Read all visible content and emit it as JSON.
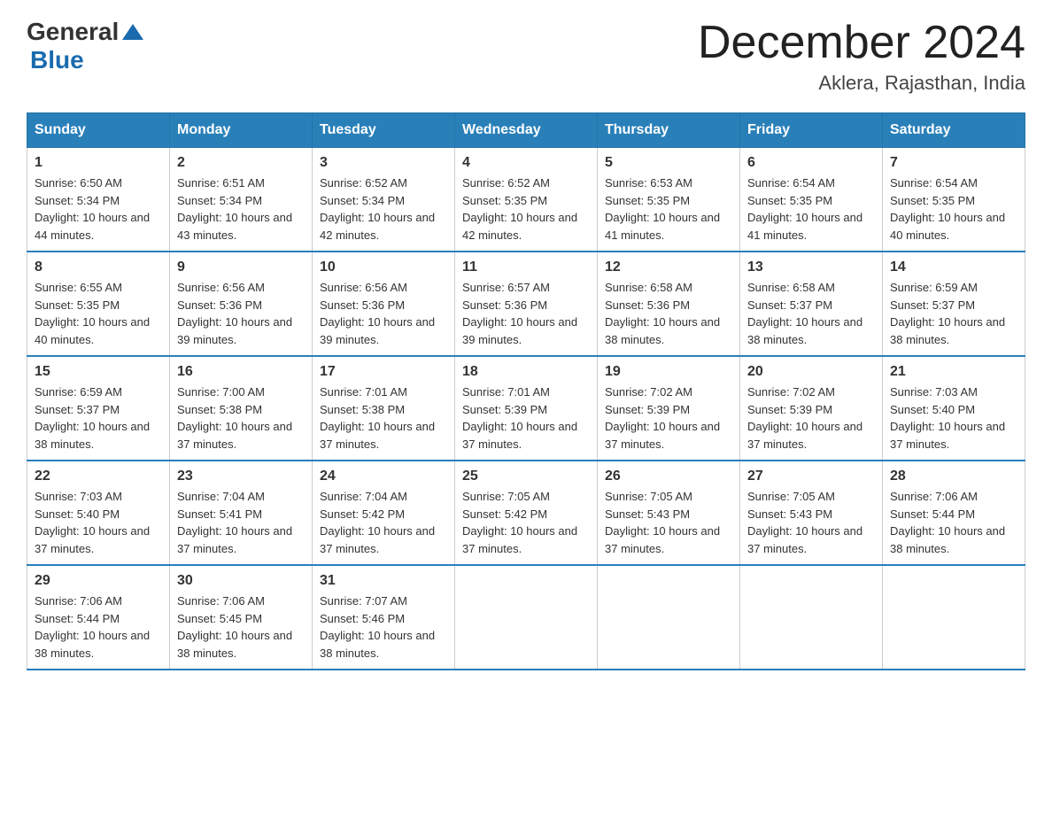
{
  "logo": {
    "text_general": "General",
    "text_blue": "Blue"
  },
  "header": {
    "month": "December 2024",
    "location": "Aklera, Rajasthan, India"
  },
  "weekdays": [
    "Sunday",
    "Monday",
    "Tuesday",
    "Wednesday",
    "Thursday",
    "Friday",
    "Saturday"
  ],
  "weeks": [
    [
      {
        "day": "1",
        "sunrise": "6:50 AM",
        "sunset": "5:34 PM",
        "daylight": "10 hours and 44 minutes."
      },
      {
        "day": "2",
        "sunrise": "6:51 AM",
        "sunset": "5:34 PM",
        "daylight": "10 hours and 43 minutes."
      },
      {
        "day": "3",
        "sunrise": "6:52 AM",
        "sunset": "5:34 PM",
        "daylight": "10 hours and 42 minutes."
      },
      {
        "day": "4",
        "sunrise": "6:52 AM",
        "sunset": "5:35 PM",
        "daylight": "10 hours and 42 minutes."
      },
      {
        "day": "5",
        "sunrise": "6:53 AM",
        "sunset": "5:35 PM",
        "daylight": "10 hours and 41 minutes."
      },
      {
        "day": "6",
        "sunrise": "6:54 AM",
        "sunset": "5:35 PM",
        "daylight": "10 hours and 41 minutes."
      },
      {
        "day": "7",
        "sunrise": "6:54 AM",
        "sunset": "5:35 PM",
        "daylight": "10 hours and 40 minutes."
      }
    ],
    [
      {
        "day": "8",
        "sunrise": "6:55 AM",
        "sunset": "5:35 PM",
        "daylight": "10 hours and 40 minutes."
      },
      {
        "day": "9",
        "sunrise": "6:56 AM",
        "sunset": "5:36 PM",
        "daylight": "10 hours and 39 minutes."
      },
      {
        "day": "10",
        "sunrise": "6:56 AM",
        "sunset": "5:36 PM",
        "daylight": "10 hours and 39 minutes."
      },
      {
        "day": "11",
        "sunrise": "6:57 AM",
        "sunset": "5:36 PM",
        "daylight": "10 hours and 39 minutes."
      },
      {
        "day": "12",
        "sunrise": "6:58 AM",
        "sunset": "5:36 PM",
        "daylight": "10 hours and 38 minutes."
      },
      {
        "day": "13",
        "sunrise": "6:58 AM",
        "sunset": "5:37 PM",
        "daylight": "10 hours and 38 minutes."
      },
      {
        "day": "14",
        "sunrise": "6:59 AM",
        "sunset": "5:37 PM",
        "daylight": "10 hours and 38 minutes."
      }
    ],
    [
      {
        "day": "15",
        "sunrise": "6:59 AM",
        "sunset": "5:37 PM",
        "daylight": "10 hours and 38 minutes."
      },
      {
        "day": "16",
        "sunrise": "7:00 AM",
        "sunset": "5:38 PM",
        "daylight": "10 hours and 37 minutes."
      },
      {
        "day": "17",
        "sunrise": "7:01 AM",
        "sunset": "5:38 PM",
        "daylight": "10 hours and 37 minutes."
      },
      {
        "day": "18",
        "sunrise": "7:01 AM",
        "sunset": "5:39 PM",
        "daylight": "10 hours and 37 minutes."
      },
      {
        "day": "19",
        "sunrise": "7:02 AM",
        "sunset": "5:39 PM",
        "daylight": "10 hours and 37 minutes."
      },
      {
        "day": "20",
        "sunrise": "7:02 AM",
        "sunset": "5:39 PM",
        "daylight": "10 hours and 37 minutes."
      },
      {
        "day": "21",
        "sunrise": "7:03 AM",
        "sunset": "5:40 PM",
        "daylight": "10 hours and 37 minutes."
      }
    ],
    [
      {
        "day": "22",
        "sunrise": "7:03 AM",
        "sunset": "5:40 PM",
        "daylight": "10 hours and 37 minutes."
      },
      {
        "day": "23",
        "sunrise": "7:04 AM",
        "sunset": "5:41 PM",
        "daylight": "10 hours and 37 minutes."
      },
      {
        "day": "24",
        "sunrise": "7:04 AM",
        "sunset": "5:42 PM",
        "daylight": "10 hours and 37 minutes."
      },
      {
        "day": "25",
        "sunrise": "7:05 AM",
        "sunset": "5:42 PM",
        "daylight": "10 hours and 37 minutes."
      },
      {
        "day": "26",
        "sunrise": "7:05 AM",
        "sunset": "5:43 PM",
        "daylight": "10 hours and 37 minutes."
      },
      {
        "day": "27",
        "sunrise": "7:05 AM",
        "sunset": "5:43 PM",
        "daylight": "10 hours and 37 minutes."
      },
      {
        "day": "28",
        "sunrise": "7:06 AM",
        "sunset": "5:44 PM",
        "daylight": "10 hours and 38 minutes."
      }
    ],
    [
      {
        "day": "29",
        "sunrise": "7:06 AM",
        "sunset": "5:44 PM",
        "daylight": "10 hours and 38 minutes."
      },
      {
        "day": "30",
        "sunrise": "7:06 AM",
        "sunset": "5:45 PM",
        "daylight": "10 hours and 38 minutes."
      },
      {
        "day": "31",
        "sunrise": "7:07 AM",
        "sunset": "5:46 PM",
        "daylight": "10 hours and 38 minutes."
      },
      null,
      null,
      null,
      null
    ]
  ]
}
